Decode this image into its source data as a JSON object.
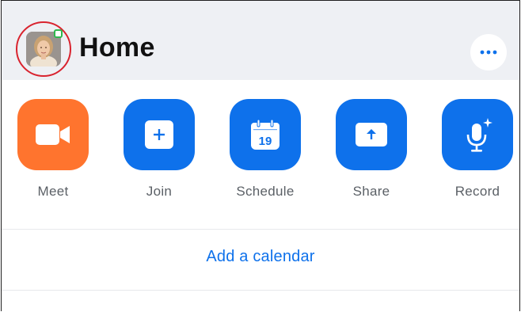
{
  "header": {
    "title": "Home",
    "avatar_icon": "user-photo",
    "status_color": "#2fb84f",
    "more_icon": "ellipsis-icon"
  },
  "actions": [
    {
      "label": "Meet",
      "icon": "video-camera-icon",
      "color": "#ff742e"
    },
    {
      "label": "Join",
      "icon": "plus-icon",
      "color": "#0e71eb"
    },
    {
      "label": "Schedule",
      "icon": "calendar-icon",
      "color": "#0e71eb",
      "calendar_day": "19"
    },
    {
      "label": "Share",
      "icon": "share-upload-icon",
      "color": "#0e71eb"
    },
    {
      "label": "Record",
      "icon": "microphone-icon",
      "color": "#0e71eb"
    }
  ],
  "calendar": {
    "link_label": "Add a calendar"
  },
  "colors": {
    "accent": "#0e71eb",
    "highlight_ring": "#d9232e",
    "header_bg": "#eef0f4"
  }
}
